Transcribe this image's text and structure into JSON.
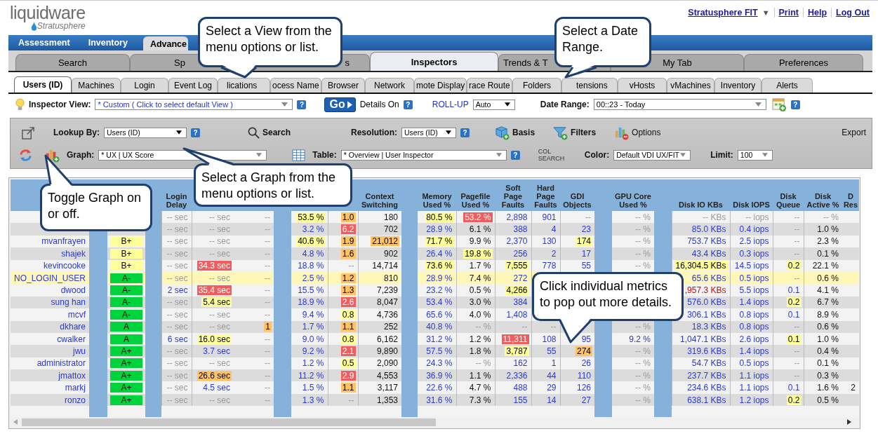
{
  "header": {
    "logo": "liquidware",
    "logo_sub": "Stratusphere",
    "product_menu": {
      "label": "Stratusphere FIT",
      "caret": "▼"
    },
    "links": [
      "Print",
      "Help",
      "Log Out"
    ]
  },
  "main_tabs": [
    {
      "label": "Assessment",
      "selected": false
    },
    {
      "label": "Inventory",
      "selected": false
    },
    {
      "label": "Advance",
      "selected": true
    }
  ],
  "section_tabs": [
    {
      "label": "Search",
      "selected": false
    },
    {
      "label": "Sp",
      "selected": false
    },
    {
      "label": "s",
      "selected": false
    },
    {
      "label": "Inspectors",
      "selected": true
    },
    {
      "label": "Trends & T",
      "selected": false
    },
    {
      "label": "My Tab",
      "selected": false
    },
    {
      "label": "Preferences",
      "selected": false
    }
  ],
  "inspector_tabs": [
    {
      "label": "Users (ID)",
      "selected": true
    },
    {
      "label": "Machines",
      "selected": false
    },
    {
      "label": "Login",
      "selected": false
    },
    {
      "label": "Event Log",
      "selected": false
    },
    {
      "label": "lications",
      "selected": false
    },
    {
      "label": "ocess Name",
      "selected": false
    },
    {
      "label": "Browser",
      "selected": false
    },
    {
      "label": "Network",
      "selected": false
    },
    {
      "label": "mote Display",
      "selected": false
    },
    {
      "label": "race Route",
      "selected": false
    },
    {
      "label": "Folders",
      "selected": false
    },
    {
      "label": "tensions",
      "selected": false
    },
    {
      "label": "vHosts",
      "selected": false
    },
    {
      "label": "vMachines",
      "selected": false
    },
    {
      "label": "Inventory",
      "selected": false
    },
    {
      "label": "Alerts",
      "selected": false
    }
  ],
  "inspector_view": {
    "label": "Inspector View:",
    "value": "* Custom ( Click to select default View )",
    "help": "?"
  },
  "go_button": "Go",
  "details": {
    "label": "Details On",
    "help": "?"
  },
  "rollup": {
    "label": "ROLL-UP",
    "value": "Auto"
  },
  "date_range": {
    "label": "Date Range:",
    "value": "00::23 - Today",
    "help": "?"
  },
  "toolbar": {
    "lookup": {
      "label": "Lookup By:",
      "value": "Users (ID)",
      "help": "?"
    },
    "search": "Search",
    "resolution": {
      "label": "Resolution:",
      "value": "Users (ID)",
      "help": "?"
    },
    "basis": "Basis",
    "filters": "Filters",
    "options": "Options",
    "export": "Export",
    "graph": {
      "label": "Graph:",
      "value": "* UX | UX Score"
    },
    "table": {
      "label": "Table:",
      "value": "* Overview | User Inspector",
      "help": "?"
    },
    "col_search": "COL SEARCH",
    "color": {
      "label": "Color:",
      "value": "Default VDI UX/FIT"
    },
    "limit": {
      "label": "Limit:",
      "value": "100"
    }
  },
  "table": {
    "groups": [
      {
        "columns": [
          {
            "kind": "user"
          }
        ]
      },
      {
        "columns": [
          {
            "kind": "grade"
          }
        ]
      },
      {
        "columns": [
          {
            "label": "Login Delay",
            "kind": "link"
          },
          {
            "kind": "link"
          },
          {
            "kind": "plain"
          }
        ]
      },
      {
        "columns": [
          {
            "kind": "link"
          },
          {
            "kind": "plain"
          },
          {
            "label": "Context Switching",
            "kind": "plain"
          }
        ]
      },
      {
        "columns": [
          {
            "label": "Memory Used %",
            "kind": "link"
          },
          {
            "label": "Pagefile Used %",
            "kind": "plain"
          },
          {
            "label": "Soft Page Faults",
            "kind": "link"
          },
          {
            "label": "Hard Page Faults",
            "kind": "link"
          },
          {
            "label": "GDI Objects",
            "kind": "link"
          }
        ]
      },
      {
        "columns": [
          {
            "label": "GPU Core Used %",
            "kind": "link"
          }
        ]
      },
      {
        "columns": [
          {
            "label": "Disk IO KBs",
            "kind": "link"
          },
          {
            "label": "Disk IOPS",
            "kind": "link"
          },
          {
            "label": "Disk Queue",
            "kind": "link"
          },
          {
            "label": "Disk Active %",
            "kind": "plain"
          },
          {
            "label": "D Res",
            "kind": "plain"
          }
        ]
      }
    ],
    "rows": [
      {
        "selected": false,
        "cells": [
          null,
          null,
          {
            "text": "-- sec",
            "muted": true
          },
          {
            "text": "-- sec",
            "muted": true
          },
          {
            "text": "--",
            "muted": true
          },
          {
            "text": "53.5 %",
            "color": "#ffff99"
          },
          {
            "text": "1.0",
            "color": "#ffc266"
          },
          "180",
          {
            "text": "80.5 %",
            "color": "#ffff99"
          },
          {
            "text": "53.2 %",
            "color": "#f25c5c"
          },
          "2,898",
          "901",
          {
            "text": "--",
            "muted": true
          },
          {
            "text": "-- %",
            "muted": true
          },
          {
            "text": "-- KBs",
            "muted": true
          },
          {
            "text": "-- iops",
            "muted": true
          },
          {
            "text": "--",
            "muted": true
          },
          {
            "text": "-- %",
            "muted": true
          },
          null
        ]
      },
      {
        "selected": false,
        "cells": [
          null,
          null,
          {
            "text": "-- sec",
            "muted": true
          },
          {
            "text": "-- sec",
            "muted": true
          },
          {
            "text": "--",
            "muted": true
          },
          "3.2 %",
          {
            "text": "6.2",
            "color": "#f25c5c"
          },
          "702",
          "28.9 %",
          "6.1 %",
          "388",
          "4",
          "23",
          {
            "text": "-- %",
            "muted": true
          },
          "85.0 KBs",
          "0.4 iops",
          {
            "text": "--",
            "muted": true
          },
          "1.0 %",
          null
        ]
      },
      {
        "selected": false,
        "cells": [
          "mvanfrayen",
          {
            "text": "B+",
            "color": "#ffff99"
          },
          {
            "text": "-- sec",
            "muted": true
          },
          {
            "text": "-- sec",
            "muted": true
          },
          {
            "text": "--",
            "muted": true
          },
          {
            "text": "40.6 %",
            "color": "#ffff99"
          },
          {
            "text": "1.9",
            "color": "#ffc266"
          },
          {
            "text": "21,012",
            "color": "#ffc266"
          },
          {
            "text": "71.7 %",
            "color": "#ffff99"
          },
          "9.9 %",
          "2,370",
          "130",
          {
            "text": "174",
            "color": "#ffff99"
          },
          {
            "text": "-- %",
            "muted": true
          },
          "753.7 KBs",
          "2.5 iops",
          {
            "text": "--",
            "muted": true
          },
          "2.3 %",
          null
        ]
      },
      {
        "selected": false,
        "cells": [
          "shajek",
          {
            "text": "B+",
            "color": "#ffff99"
          },
          {
            "text": "-- sec",
            "muted": true
          },
          {
            "text": "-- sec",
            "muted": true
          },
          {
            "text": "--",
            "muted": true
          },
          "4.8 %",
          {
            "text": "1.6",
            "color": "#ffc266"
          },
          "902",
          "26.4 %",
          {
            "text": "19.8 %",
            "color": "#ffff99"
          },
          "256",
          "2",
          "17",
          {
            "text": "-- %",
            "muted": true
          },
          "43.4 KBs",
          "0.3 iops",
          {
            "text": "--",
            "muted": true
          },
          "0.1 %",
          null
        ]
      },
      {
        "selected": false,
        "cells": [
          "kevincooke",
          {
            "text": "B+",
            "color": "#ffff99"
          },
          {
            "text": "-- sec",
            "muted": true
          },
          {
            "text": "34.3 sec",
            "color": "#f25c5c"
          },
          {
            "text": "--",
            "muted": true
          },
          "18.8 %",
          {
            "text": "--",
            "muted": true
          },
          "14,714",
          {
            "text": "73.6 %",
            "color": "#ffff99"
          },
          "1.7 %",
          {
            "text": "7,555",
            "color": "#ffff99"
          },
          "778",
          "55",
          {
            "text": "-- %",
            "muted": true
          },
          {
            "text": "16,304.5 KBs",
            "color": "#ffff99"
          },
          "14.5 iops",
          {
            "text": "0.2",
            "color": "#ffff99"
          },
          "22.1 %",
          null
        ]
      },
      {
        "selected": true,
        "cells": [
          "NO_LOGIN_USER",
          {
            "text": "A-",
            "color": "#00d43c"
          },
          {
            "text": "-- sec",
            "muted": true
          },
          {
            "text": "-- sec",
            "muted": true
          },
          {
            "text": "--",
            "muted": true
          },
          "2.5 %",
          {
            "text": "1.2",
            "color": "#ffc266"
          },
          "810",
          "28.9 %",
          "7.4 %",
          "272",
          null,
          null,
          null,
          "65.6 KBs",
          "0.5 iops",
          {
            "text": "--",
            "muted": true
          },
          "0.6 %",
          null
        ]
      },
      {
        "selected": false,
        "cells": [
          "dwood",
          {
            "text": "A-",
            "color": "#00d43c"
          },
          "2 sec",
          {
            "text": "35.4 sec",
            "color": "#f25c5c"
          },
          {
            "text": "--",
            "muted": true
          },
          "15.5 %",
          {
            "text": "1.3",
            "color": "#ffc266"
          },
          "7,239",
          "23.2 %",
          "0.5 %",
          {
            "text": "4,266",
            "color": "#ffff99"
          },
          null,
          null,
          null,
          {
            "text": ",957.3 KBs",
            "alert": true
          },
          "5.5 iops",
          "0.1",
          "4.1 %",
          null
        ]
      },
      {
        "selected": false,
        "cells": [
          "sung han",
          {
            "text": "A-",
            "color": "#00d43c"
          },
          {
            "text": "-- sec",
            "muted": true
          },
          {
            "text": "5.4 sec",
            "color": "#ffff99"
          },
          {
            "text": "--",
            "muted": true
          },
          "18.9 %",
          {
            "text": "2.6",
            "color": "#f25c5c"
          },
          "8,047",
          "53.4 %",
          "3.0 %",
          "384",
          null,
          null,
          null,
          "576.0 KBs",
          "1.4 iops",
          {
            "text": "0.2",
            "color": "#ffff99"
          },
          "6.7 %",
          null
        ]
      },
      {
        "selected": false,
        "cells": [
          "mcvf",
          {
            "text": "A-",
            "color": "#00d43c"
          },
          {
            "text": "-- sec",
            "muted": true
          },
          {
            "text": "-- sec",
            "muted": true
          },
          {
            "text": "--",
            "muted": true
          },
          "9.4 %",
          {
            "text": "0.8",
            "color": "#ffff99"
          },
          "4,736",
          "65.6 %",
          "4.0 %",
          "1,408",
          null,
          null,
          null,
          "306.1 KBs",
          "0.8 iops",
          "0.1",
          "8.9 %",
          null
        ]
      },
      {
        "selected": false,
        "cells": [
          "dkhare",
          {
            "text": "A",
            "color": "#00d43c"
          },
          {
            "text": "-- sec",
            "muted": true
          },
          {
            "text": "-- sec",
            "muted": true
          },
          {
            "text": "1",
            "color": "#ffc266"
          },
          "1.7 %",
          {
            "text": "1.1",
            "color": "#ffc266"
          },
          "252",
          "40.8 %",
          {
            "text": "-- %",
            "muted": true
          },
          {
            "text": "--",
            "muted": true
          },
          {
            "text": "--",
            "muted": true
          },
          null,
          {
            "text": "-- %",
            "muted": true
          },
          "18.3 KBs",
          "0.8 iops",
          {
            "text": "--",
            "muted": true
          },
          "0.6 %",
          null
        ]
      },
      {
        "selected": false,
        "cells": [
          "cwalker",
          {
            "text": "A",
            "color": "#00d43c"
          },
          "6 sec",
          {
            "text": "16.0 sec",
            "color": "#ffff99"
          },
          {
            "text": "--",
            "muted": true
          },
          "9.0 %",
          {
            "text": "0.8",
            "color": "#ffff99"
          },
          "6,162",
          "31.2 %",
          "1.2 %",
          {
            "text": "11,311",
            "color": "#f25c5c"
          },
          "108",
          "95",
          "9.2 %",
          "1,047.1 KBs",
          "2.6 iops",
          {
            "text": "0.1",
            "color": "#ffff99"
          },
          "1.0 %",
          null
        ]
      },
      {
        "selected": false,
        "cells": [
          "jwu",
          {
            "text": "A+",
            "color": "#00d43c"
          },
          {
            "text": "-- sec",
            "muted": true
          },
          "3.7 sec",
          {
            "text": "--",
            "muted": true
          },
          "9.2 %",
          {
            "text": "2.1",
            "color": "#f25c5c"
          },
          "9,890",
          "57.5 %",
          "1.8 %",
          {
            "text": "3,787",
            "color": "#ffff99"
          },
          "55",
          {
            "text": "274",
            "color": "#ffc266"
          },
          {
            "text": "-- %",
            "muted": true
          },
          "319.6 KBs",
          "1.4 iops",
          {
            "text": "--",
            "muted": true
          },
          "0.4 %",
          null
        ]
      },
      {
        "selected": false,
        "cells": [
          "administrator",
          {
            "text": "A+",
            "color": "#00d43c"
          },
          {
            "text": "-- sec",
            "muted": true
          },
          {
            "text": "-- sec",
            "muted": true
          },
          {
            "text": "--",
            "muted": true
          },
          "1.2 %",
          {
            "text": "0.5",
            "color": "#ffff99"
          },
          "2,090",
          "24.3 %",
          {
            "text": "-- %",
            "muted": true
          },
          "162",
          "1",
          "26",
          {
            "text": "-- %",
            "muted": true
          },
          "54.7 KBs",
          "0.5 iops",
          {
            "text": "--",
            "muted": true
          },
          "0.1 %",
          null
        ]
      },
      {
        "selected": false,
        "cells": [
          "jmattox",
          {
            "text": "A+",
            "color": "#00d43c"
          },
          {
            "text": "-- sec",
            "muted": true
          },
          {
            "text": "26.6 sec",
            "color": "#ffc266"
          },
          {
            "text": "--",
            "muted": true
          },
          "11.2 %",
          {
            "text": "2.9",
            "color": "#f25c5c"
          },
          "4,553",
          "36.9 %",
          "1.1 %",
          "2,336",
          "44",
          "110",
          {
            "text": "-- %",
            "muted": true
          },
          "237.7 KBs",
          "1.1 iops",
          {
            "text": "--",
            "muted": true
          },
          "0.3 %",
          null
        ]
      },
      {
        "selected": false,
        "cells": [
          "markj",
          {
            "text": "A+",
            "color": "#00d43c"
          },
          {
            "text": "-- sec",
            "muted": true
          },
          "4.5 sec",
          {
            "text": "--",
            "muted": true
          },
          "1.5 %",
          {
            "text": "1.1",
            "color": "#ffc266"
          },
          "3,117",
          "22.6 %",
          "4.7 %",
          "488",
          "29",
          "126",
          {
            "text": "-- %",
            "muted": true
          },
          "234.6 KBs",
          "1.1 iops",
          "0.1",
          "1.6 %",
          "2"
        ]
      },
      {
        "selected": false,
        "cells": [
          "ronzo",
          {
            "text": "A+",
            "color": "#00d43c"
          },
          {
            "text": "-- sec",
            "muted": true
          },
          {
            "text": "-- sec",
            "muted": true
          },
          {
            "text": "--",
            "muted": true
          },
          "1.3 %",
          {
            "text": "--",
            "muted": true
          },
          "1,353",
          "31.6 %",
          "7.3 %",
          "155",
          "14",
          "27",
          {
            "text": "-- %",
            "muted": true
          },
          "638.1 KBs",
          "1.2 iops",
          {
            "text": "0.2",
            "color": "#ffff99"
          },
          "0.5 %",
          null
        ]
      }
    ]
  },
  "callouts": [
    {
      "kind": "view",
      "text": "Select a View from the menu options or list."
    },
    {
      "kind": "date",
      "text": "Select a Date Range."
    },
    {
      "kind": "graph",
      "text": "Select a Graph from the menu options or list."
    },
    {
      "kind": "toggle",
      "text": "Toggle Graph on or off."
    },
    {
      "kind": "metrics",
      "text": "Click individual metrics to pop out more details."
    }
  ]
}
